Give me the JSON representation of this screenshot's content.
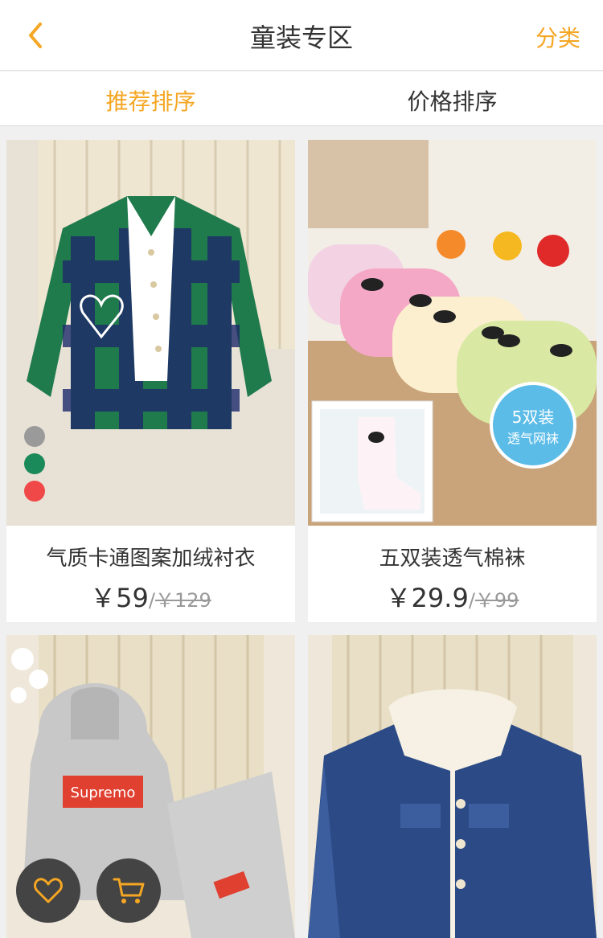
{
  "header": {
    "title": "童装专区",
    "category": "分类"
  },
  "sort": {
    "recommended": "推荐排序",
    "price": "价格排序"
  },
  "products": [
    {
      "name": "气质卡通图案加绒衬衣",
      "price": "￥59",
      "sep": "/",
      "old_price": "￥129"
    },
    {
      "name": "五双装透气棉袜",
      "price": "￥29.9",
      "sep": "/",
      "old_price": "￥99"
    },
    {
      "name": "",
      "price": "",
      "sep": "",
      "old_price": ""
    },
    {
      "name": "",
      "price": "",
      "sep": "",
      "old_price": ""
    }
  ],
  "socks_badge": {
    "line1": "5双装",
    "line2": "透气网袜"
  },
  "hoodie_logo": "Supremo",
  "colors": {
    "accent": "#f5a623",
    "fab": "#444444"
  }
}
